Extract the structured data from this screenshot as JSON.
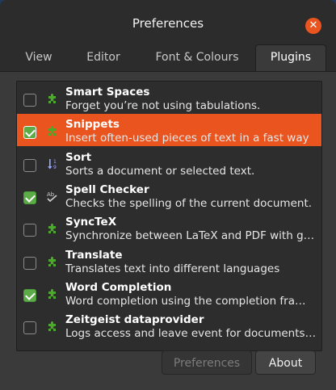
{
  "window": {
    "title": "Preferences"
  },
  "tabs": [
    {
      "label": "View",
      "active": false
    },
    {
      "label": "Editor",
      "active": false
    },
    {
      "label": "Font & Colours",
      "active": false
    },
    {
      "label": "Plugins",
      "active": true
    }
  ],
  "plugins": [
    {
      "name": "Smart Spaces",
      "description": "Forget you’re not using tabulations.",
      "enabled": false,
      "selected": false,
      "icon": "puzzle-piece-icon"
    },
    {
      "name": "Snippets",
      "description": "Insert often-used pieces of text in a fast way",
      "enabled": true,
      "selected": true,
      "icon": "puzzle-piece-icon"
    },
    {
      "name": "Sort",
      "description": "Sorts a document or selected text.",
      "enabled": false,
      "selected": false,
      "icon": "sort-icon"
    },
    {
      "name": "Spell Checker",
      "description": "Checks the spelling of the current document.",
      "enabled": true,
      "selected": false,
      "icon": "spell-check-icon"
    },
    {
      "name": "SyncTeX",
      "description": "Synchronize between LaTeX and PDF with ge…",
      "enabled": false,
      "selected": false,
      "icon": "puzzle-piece-icon"
    },
    {
      "name": "Translate",
      "description": "Translates text into different languages",
      "enabled": false,
      "selected": false,
      "icon": "puzzle-piece-icon"
    },
    {
      "name": "Word Completion",
      "description": "Word completion using the completion fra…",
      "enabled": true,
      "selected": false,
      "icon": "puzzle-piece-icon"
    },
    {
      "name": "Zeitgeist dataprovider",
      "description": "Logs access and leave event for documents …",
      "enabled": false,
      "selected": false,
      "icon": "puzzle-piece-icon"
    }
  ],
  "buttons": {
    "preferences": {
      "label": "Preferences",
      "enabled": false
    },
    "about": {
      "label": "About",
      "enabled": true
    }
  },
  "colors": {
    "accent": "#e9541f",
    "check": "#5bab47",
    "icon_green": "#4caa2a"
  }
}
